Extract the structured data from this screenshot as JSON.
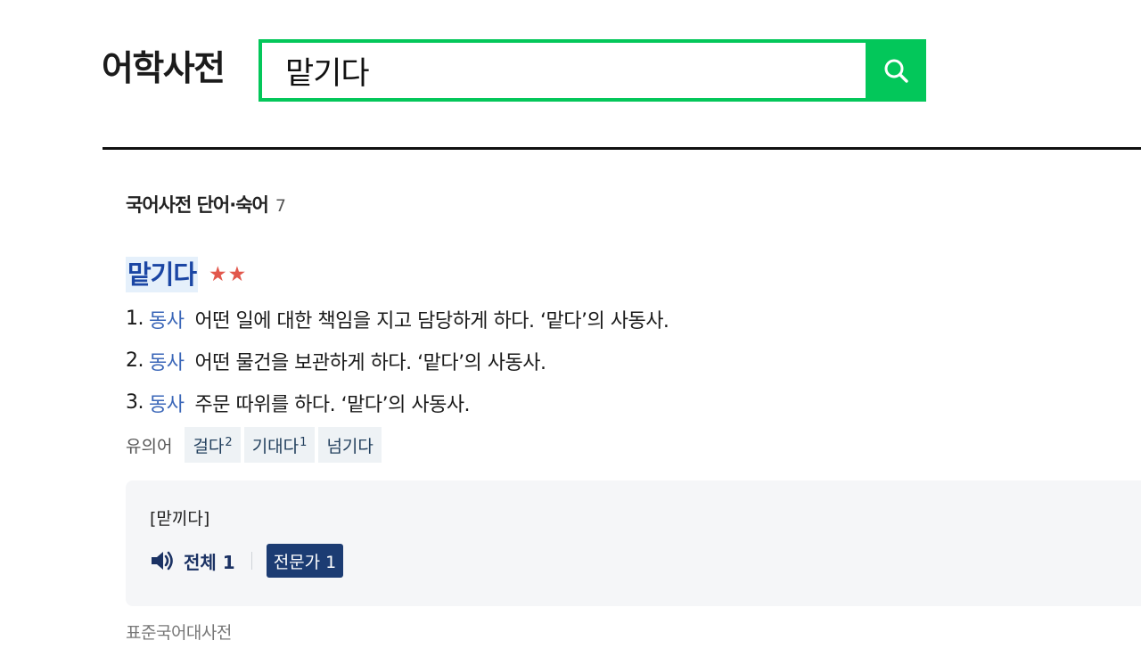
{
  "header": {
    "brand": "어학사전",
    "search_value": "맡기다"
  },
  "section": {
    "title": "국어사전 단어·숙어",
    "count": "7"
  },
  "entry": {
    "word": "맡기다",
    "stars": "★★",
    "definitions": [
      {
        "num": "1.",
        "pos": "동사",
        "text": "어떤 일에 대한 책임을 지고 담당하게 하다. ‘맡다’의 사동사."
      },
      {
        "num": "2.",
        "pos": "동사",
        "text": "어떤 물건을 보관하게 하다. ‘맡다’의 사동사."
      },
      {
        "num": "3.",
        "pos": "동사",
        "text": "주문 따위를 하다. ‘맡다’의 사동사."
      }
    ],
    "synonym_label": "유의어",
    "synonyms": [
      {
        "word": "걸다",
        "sup": "2"
      },
      {
        "word": "기대다",
        "sup": "1"
      },
      {
        "word": "넘기다",
        "sup": ""
      }
    ],
    "pronunciation": "[맏끼다]",
    "audio_all_label": "전체 1",
    "audio_expert_label": "전문가 1",
    "source": "표준국어대사전"
  },
  "colors": {
    "accent": "#03c75a",
    "link": "#1b46a4",
    "pos": "#3a66b8",
    "stars": "#e2574c",
    "expert_chip": "#1c3c73"
  }
}
